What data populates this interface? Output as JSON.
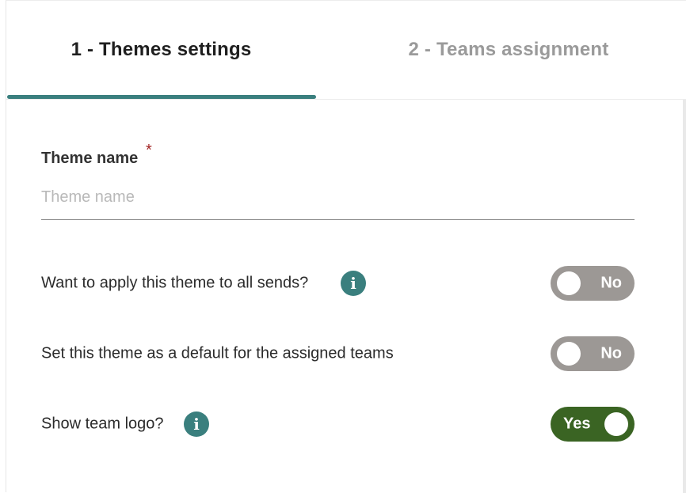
{
  "tabs": [
    {
      "label": "1 - Themes settings",
      "active": true
    },
    {
      "label": "2 - Teams assignment",
      "active": false
    }
  ],
  "form": {
    "theme_name": {
      "label": "Theme name",
      "required_mark": "*",
      "placeholder": "Theme name",
      "value": ""
    },
    "settings": [
      {
        "label": "Want to apply this theme to all sends?",
        "has_info": true,
        "info_icon": "info-icon",
        "toggle_label": "No",
        "enabled": false
      },
      {
        "label": "Set this theme as a default for the assigned teams",
        "has_info": false,
        "toggle_label": "No",
        "enabled": false
      },
      {
        "label": "Show team logo?",
        "has_info": true,
        "info_icon": "info-icon",
        "toggle_label": "Yes",
        "enabled": true
      }
    ]
  },
  "colors": {
    "accent": "#3a7f7e",
    "toggle_off": "#9c9895",
    "toggle_on": "#3a6423",
    "required": "#a32424"
  }
}
